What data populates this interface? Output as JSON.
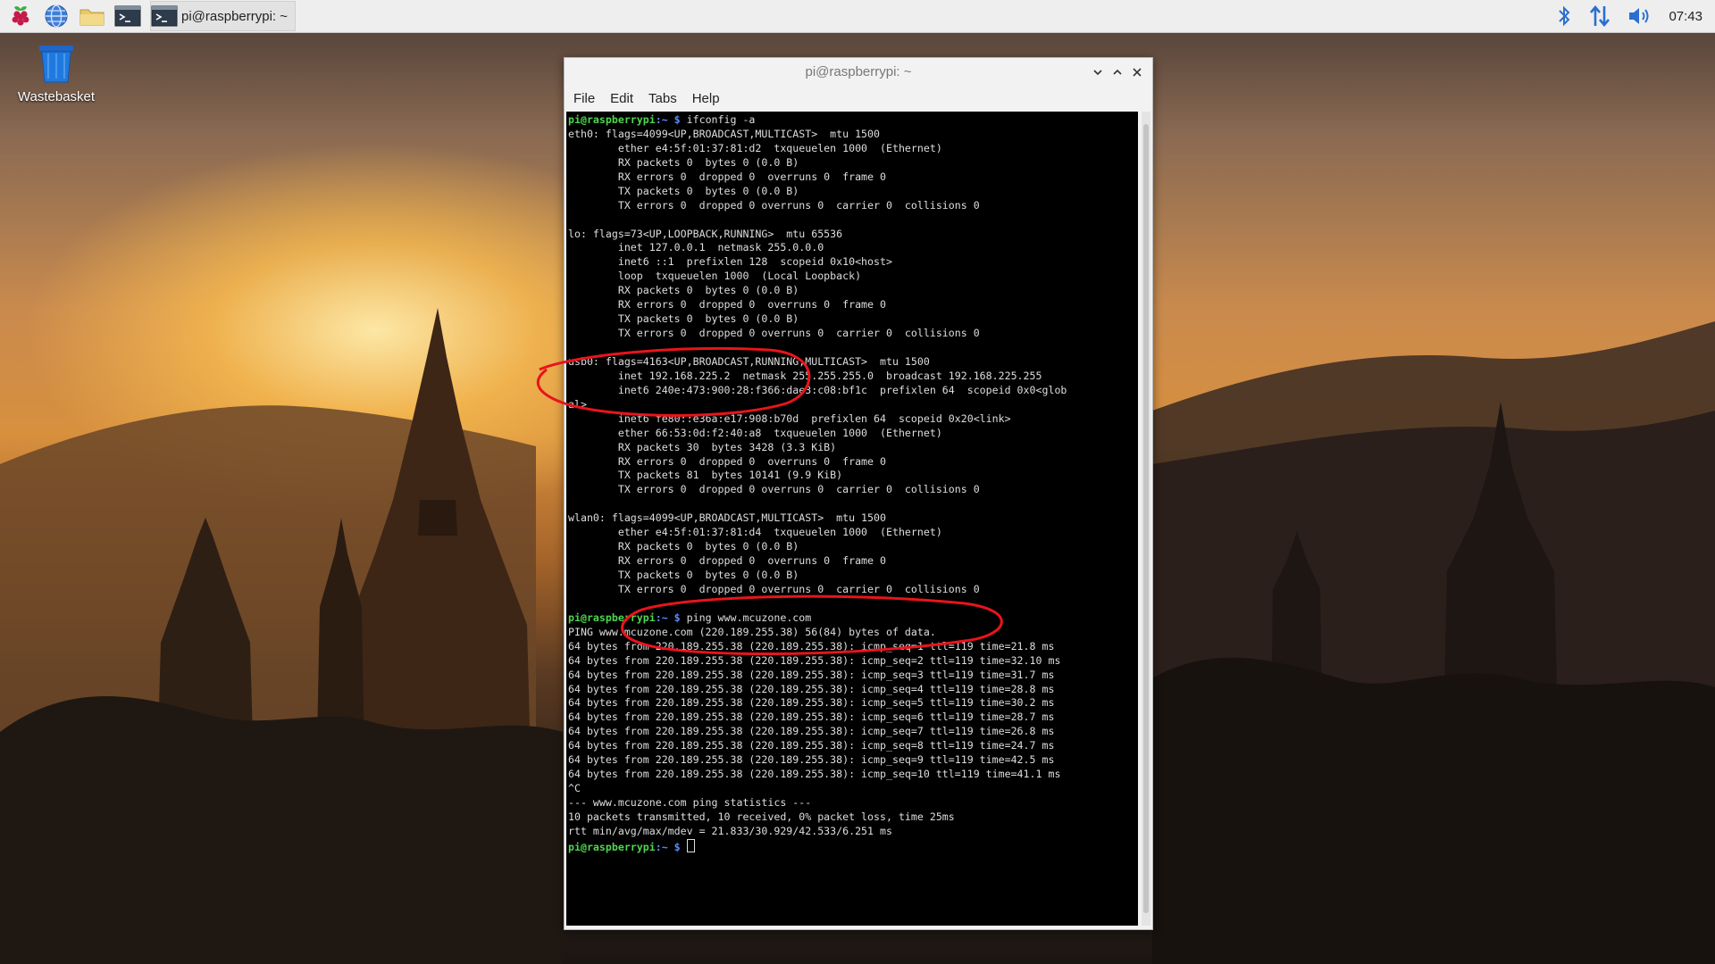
{
  "taskbar": {
    "launchers": [
      {
        "name": "raspberry-menu",
        "icon": "raspberry-icon"
      },
      {
        "name": "web-browser",
        "icon": "globe-icon"
      },
      {
        "name": "file-manager",
        "icon": "folder-icon"
      },
      {
        "name": "terminal",
        "icon": "terminal-icon"
      }
    ],
    "active_app": {
      "label": "pi@raspberrypi: ~",
      "icon": "terminal-icon"
    },
    "tray": {
      "bluetooth_icon": "bluetooth-icon",
      "network_icon": "network-updown-icon",
      "volume_icon": "volume-icon",
      "clock": "07:43"
    }
  },
  "desktop": {
    "icons": [
      {
        "label": "Wastebasket",
        "icon": "trash-icon"
      }
    ]
  },
  "window": {
    "title": "pi@raspberrypi: ~",
    "controls": [
      "minimize-icon",
      "maximize-icon",
      "close-icon"
    ],
    "menu": [
      "File",
      "Edit",
      "Tabs",
      "Help"
    ]
  },
  "terminal": {
    "prompt_user": "pi@raspberrypi",
    "prompt_dir": ":~",
    "prompt_symbol": " $",
    "lines": [
      {
        "prompt": true,
        "cmd": " ifconfig -a"
      },
      {
        "text": "eth0: flags=4099<UP,BROADCAST,MULTICAST>  mtu 1500"
      },
      {
        "text": "        ether e4:5f:01:37:81:d2  txqueuelen 1000  (Ethernet)"
      },
      {
        "text": "        RX packets 0  bytes 0 (0.0 B)"
      },
      {
        "text": "        RX errors 0  dropped 0  overruns 0  frame 0"
      },
      {
        "text": "        TX packets 0  bytes 0 (0.0 B)"
      },
      {
        "text": "        TX errors 0  dropped 0 overruns 0  carrier 0  collisions 0"
      },
      {
        "text": ""
      },
      {
        "text": "lo: flags=73<UP,LOOPBACK,RUNNING>  mtu 65536"
      },
      {
        "text": "        inet 127.0.0.1  netmask 255.0.0.0"
      },
      {
        "text": "        inet6 ::1  prefixlen 128  scopeid 0x10<host>"
      },
      {
        "text": "        loop  txqueuelen 1000  (Local Loopback)"
      },
      {
        "text": "        RX packets 0  bytes 0 (0.0 B)"
      },
      {
        "text": "        RX errors 0  dropped 0  overruns 0  frame 0"
      },
      {
        "text": "        TX packets 0  bytes 0 (0.0 B)"
      },
      {
        "text": "        TX errors 0  dropped 0 overruns 0  carrier 0  collisions 0"
      },
      {
        "text": ""
      },
      {
        "text": "usb0: flags=4163<UP,BROADCAST,RUNNING,MULTICAST>  mtu 1500"
      },
      {
        "text": "        inet 192.168.225.2  netmask 255.255.255.0  broadcast 192.168.225.255"
      },
      {
        "text": "        inet6 240e:473:900:28:f366:dae3:c08:bf1c  prefixlen 64  scopeid 0x0<glob"
      },
      {
        "text": "al>"
      },
      {
        "text": "        inet6 fe80::e36a:e17:908:b70d  prefixlen 64  scopeid 0x20<link>"
      },
      {
        "text": "        ether 66:53:0d:f2:40:a8  txqueuelen 1000  (Ethernet)"
      },
      {
        "text": "        RX packets 30  bytes 3428 (3.3 KiB)"
      },
      {
        "text": "        RX errors 0  dropped 0  overruns 0  frame 0"
      },
      {
        "text": "        TX packets 81  bytes 10141 (9.9 KiB)"
      },
      {
        "text": "        TX errors 0  dropped 0 overruns 0  carrier 0  collisions 0"
      },
      {
        "text": ""
      },
      {
        "text": "wlan0: flags=4099<UP,BROADCAST,MULTICAST>  mtu 1500"
      },
      {
        "text": "        ether e4:5f:01:37:81:d4  txqueuelen 1000  (Ethernet)"
      },
      {
        "text": "        RX packets 0  bytes 0 (0.0 B)"
      },
      {
        "text": "        RX errors 0  dropped 0  overruns 0  frame 0"
      },
      {
        "text": "        TX packets 0  bytes 0 (0.0 B)"
      },
      {
        "text": "        TX errors 0  dropped 0 overruns 0  carrier 0  collisions 0"
      },
      {
        "text": ""
      },
      {
        "prompt": true,
        "cmd": " ping www.mcuzone.com"
      },
      {
        "text": "PING www.mcuzone.com (220.189.255.38) 56(84) bytes of data."
      },
      {
        "text": "64 bytes from 220.189.255.38 (220.189.255.38): icmp_seq=1 ttl=119 time=21.8 ms"
      },
      {
        "text": "64 bytes from 220.189.255.38 (220.189.255.38): icmp_seq=2 ttl=119 time=32.10 ms"
      },
      {
        "text": "64 bytes from 220.189.255.38 (220.189.255.38): icmp_seq=3 ttl=119 time=31.7 ms"
      },
      {
        "text": "64 bytes from 220.189.255.38 (220.189.255.38): icmp_seq=4 ttl=119 time=28.8 ms"
      },
      {
        "text": "64 bytes from 220.189.255.38 (220.189.255.38): icmp_seq=5 ttl=119 time=30.2 ms"
      },
      {
        "text": "64 bytes from 220.189.255.38 (220.189.255.38): icmp_seq=6 ttl=119 time=28.7 ms"
      },
      {
        "text": "64 bytes from 220.189.255.38 (220.189.255.38): icmp_seq=7 ttl=119 time=26.8 ms"
      },
      {
        "text": "64 bytes from 220.189.255.38 (220.189.255.38): icmp_seq=8 ttl=119 time=24.7 ms"
      },
      {
        "text": "64 bytes from 220.189.255.38 (220.189.255.38): icmp_seq=9 ttl=119 time=42.5 ms"
      },
      {
        "text": "64 bytes from 220.189.255.38 (220.189.255.38): icmp_seq=10 ttl=119 time=41.1 ms"
      },
      {
        "text": "^C"
      },
      {
        "text": "--- www.mcuzone.com ping statistics ---"
      },
      {
        "text": "10 packets transmitted, 10 received, 0% packet loss, time 25ms"
      },
      {
        "text": "rtt min/avg/max/mdev = 21.833/30.929/42.533/6.251 ms"
      },
      {
        "prompt": true,
        "cmd": " ",
        "cursor": true
      }
    ]
  },
  "annotations": {
    "highlight_color": "#e8141c",
    "shape": "ellipse"
  }
}
